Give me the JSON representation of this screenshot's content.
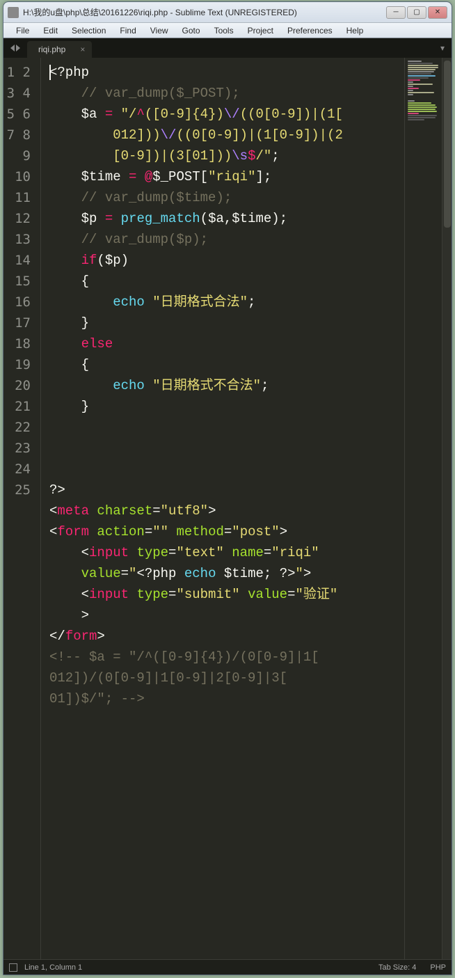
{
  "titlebar": {
    "text": "H:\\我的u盘\\php\\总结\\20161226\\riqi.php - Sublime Text (UNREGISTERED)"
  },
  "menu": [
    "File",
    "Edit",
    "Selection",
    "Find",
    "View",
    "Goto",
    "Tools",
    "Project",
    "Preferences",
    "Help"
  ],
  "tab": {
    "label": "riqi.php"
  },
  "gutter": [
    "1",
    "2",
    "3",
    "",
    "",
    "4",
    "5",
    "6",
    "7",
    "8",
    "9",
    "10",
    "11",
    "12",
    "13",
    "14",
    "15",
    "16",
    "17",
    "18",
    "19",
    "20",
    "21",
    "22",
    "",
    "23",
    "",
    "24",
    "25",
    "",
    ""
  ],
  "code": {
    "l1_open": "<?php",
    "l2_comment": "// var_dump($_POST);",
    "l3_var": "$a",
    "l3_eq": " = ",
    "l3_str_a": "\"/",
    "l3_str_b": "^",
    "l3_str_c": "([0-9]{4})",
    "l3_str_d": "\\/",
    "l3_str_e": "((0[0-9])|(1[",
    "l3b_a": "012]))",
    "l3b_b": "\\/",
    "l3b_c": "((0[0-9])|(1[0-9])|(2",
    "l3c_a": "[0-9])|(3[01]))",
    "l3c_b": "\\s",
    "l3c_c": "$",
    "l3c_d": "/\"",
    "l3_semi": ";",
    "l4_var": "$time",
    "l4_eq": " = ",
    "l4_at": "@",
    "l4_post": "$_POST",
    "l4_b1": "[",
    "l4_key": "\"riqi\"",
    "l4_b2": "]",
    "l4_semi": ";",
    "l5_comment": "// var_dump($time);",
    "l6_var": "$p",
    "l6_eq": " = ",
    "l6_fn": "preg_match",
    "l6_args": "($a,$time);",
    "l7_comment": "// var_dump($p);",
    "l8_if": "if",
    "l8_cond": "($p)",
    "l9_brace": "{",
    "l10_echo": "echo",
    "l10_sp": " ",
    "l10_str": "\"日期格式合法\"",
    "l10_semi": ";",
    "l11_brace": "}",
    "l12_else": "else",
    "l13_brace": "{",
    "l14_echo": "echo",
    "l14_sp": " ",
    "l14_str": "\"日期格式不合法\"",
    "l14_semi": ";",
    "l15_brace": "}",
    "l19_close": "?>",
    "l20_t1": "<",
    "l20_tag": "meta",
    "l20_sp": " ",
    "l20_attr": "charset",
    "l20_eq": "=",
    "l20_val": "\"utf8\"",
    "l20_t2": ">",
    "l21_t1": "<",
    "l21_tag": "form",
    "l21_sp": " ",
    "l21_a1": "action",
    "l21_e1": "=",
    "l21_v1": "\"\"",
    "l21_sp2": " ",
    "l21_a2": "method",
    "l21_e2": "=",
    "l21_v2": "\"post\"",
    "l21_t2": ">",
    "l22_t1": "<",
    "l22_tag": "input",
    "l22_sp": " ",
    "l22_a1": "type",
    "l22_e1": "=",
    "l22_v1": "\"text\"",
    "l22_sp2": " ",
    "l22_a2": "name",
    "l22_e2": "=",
    "l22_v2": "\"riqi\"",
    "l22b_a1": "value",
    "l22b_e1": "=",
    "l22b_q1": "\"",
    "l22b_php1": "<?php ",
    "l22b_echo": "echo",
    "l22b_sp": " ",
    "l22b_var": "$time",
    "l22b_semi": "; ",
    "l22b_php2": "?>",
    "l22b_q2": "\"",
    "l22b_t2": ">",
    "l23_t1": "<",
    "l23_tag": "input",
    "l23_sp": " ",
    "l23_a1": "type",
    "l23_e1": "=",
    "l23_v1": "\"submit\"",
    "l23_sp2": " ",
    "l23_a2": "value",
    "l23_e2": "=",
    "l23_v2": "\"验证\"",
    "l23b_t2": ">",
    "l24_t1": "</",
    "l24_tag": "form",
    "l24_t2": ">",
    "l25_a": "<!-- $a = \"/^([0-9]{4})/(0[0-9]|1[",
    "l25_b": "012])/(0[0-9]|1[0-9]|2[0-9]|3[",
    "l25_c": "01])$/\"; -->"
  },
  "status": {
    "pos": "Line 1, Column 1",
    "tabsize": "Tab Size: 4",
    "lang": "PHP"
  }
}
